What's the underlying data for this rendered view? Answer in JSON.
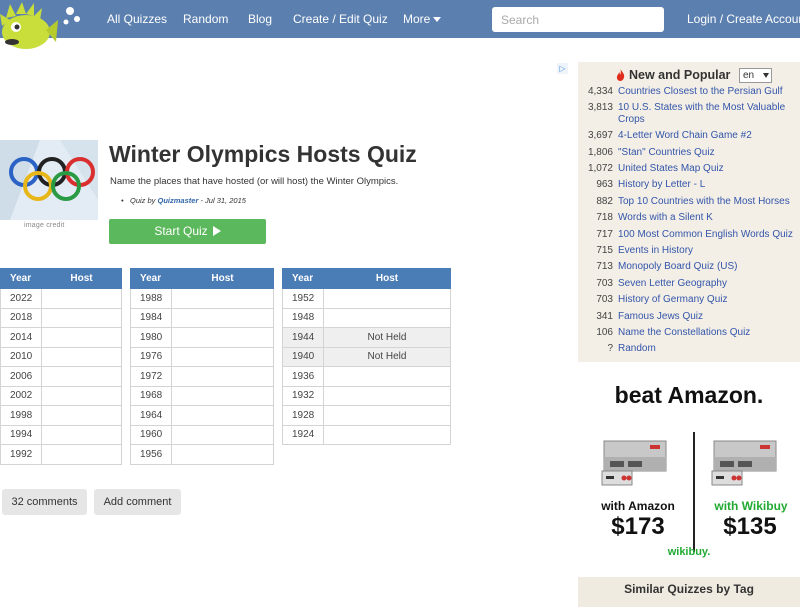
{
  "nav": {
    "links": [
      "All Quizzes",
      "Random",
      "Blog",
      "Create / Edit Quiz",
      "More"
    ],
    "search_placeholder": "Search",
    "login": "Login / Create Account"
  },
  "quiz": {
    "image_credit": "image credit",
    "title": "Winter Olympics Hosts Quiz",
    "description": "Name the places that have hosted (or will host) the Winter Olympics.",
    "meta_prefix": "Quiz by ",
    "author": "Quizmaster",
    "date": " - Jul 31, 2015",
    "start_label": "Start Quiz"
  },
  "table_headers": {
    "year": "Year",
    "host": "Host"
  },
  "tables": [
    {
      "rows": [
        {
          "year": "2022",
          "host": ""
        },
        {
          "year": "2018",
          "host": ""
        },
        {
          "year": "2014",
          "host": ""
        },
        {
          "year": "2010",
          "host": ""
        },
        {
          "year": "2006",
          "host": ""
        },
        {
          "year": "2002",
          "host": ""
        },
        {
          "year": "1998",
          "host": ""
        },
        {
          "year": "1994",
          "host": ""
        },
        {
          "year": "1992",
          "host": ""
        }
      ]
    },
    {
      "rows": [
        {
          "year": "1988",
          "host": ""
        },
        {
          "year": "1984",
          "host": ""
        },
        {
          "year": "1980",
          "host": ""
        },
        {
          "year": "1976",
          "host": ""
        },
        {
          "year": "1972",
          "host": ""
        },
        {
          "year": "1968",
          "host": ""
        },
        {
          "year": "1964",
          "host": ""
        },
        {
          "year": "1960",
          "host": ""
        },
        {
          "year": "1956",
          "host": ""
        }
      ]
    },
    {
      "rows": [
        {
          "year": "1952",
          "host": ""
        },
        {
          "year": "1948",
          "host": ""
        },
        {
          "year": "1944",
          "host": "Not Held"
        },
        {
          "year": "1940",
          "host": "Not Held"
        },
        {
          "year": "1936",
          "host": ""
        },
        {
          "year": "1932",
          "host": ""
        },
        {
          "year": "1928",
          "host": ""
        },
        {
          "year": "1924",
          "host": ""
        }
      ]
    }
  ],
  "comments": {
    "count_label": "32 comments",
    "add_label": "Add comment"
  },
  "popular": {
    "heading": "New and Popular",
    "language": "en",
    "items": [
      {
        "count": "4,334",
        "title": "Countries Closest to the Persian Gulf"
      },
      {
        "count": "3,813",
        "title": "10 U.S. States with the Most Valuable Crops"
      },
      {
        "count": "3,697",
        "title": "4-Letter Word Chain Game #2"
      },
      {
        "count": "1,806",
        "title": "\"Stan\" Countries Quiz"
      },
      {
        "count": "1,072",
        "title": "United States Map Quiz"
      },
      {
        "count": "963",
        "title": "History by Letter - L"
      },
      {
        "count": "882",
        "title": "Top 10 Countries with the Most Horses"
      },
      {
        "count": "718",
        "title": "Words with a Silent K"
      },
      {
        "count": "717",
        "title": "100 Most Common English Words Quiz"
      },
      {
        "count": "715",
        "title": "Events in History"
      },
      {
        "count": "713",
        "title": "Monopoly Board Quiz (US)"
      },
      {
        "count": "703",
        "title": "Seven Letter Geography"
      },
      {
        "count": "703",
        "title": "History of Germany Quiz"
      },
      {
        "count": "341",
        "title": "Famous Jews Quiz"
      },
      {
        "count": "106",
        "title": "Name the Constellations Quiz"
      },
      {
        "count": "?",
        "title": "Random"
      }
    ]
  },
  "ad": {
    "headline": "beat Amazon.",
    "left_label": "with Amazon",
    "left_price": "$173",
    "right_label": "with Wikibuy",
    "right_price": "$135",
    "brand": "wikibuy.",
    "colors": {
      "brand_green": "#22aa33"
    }
  },
  "similar": {
    "heading": "Similar Quizzes by Tag"
  },
  "colors": {
    "nav": "#5b7faf",
    "table_header": "#4a7cb5",
    "start_button": "#5cb85c",
    "sidebar": "#f3efe6"
  }
}
